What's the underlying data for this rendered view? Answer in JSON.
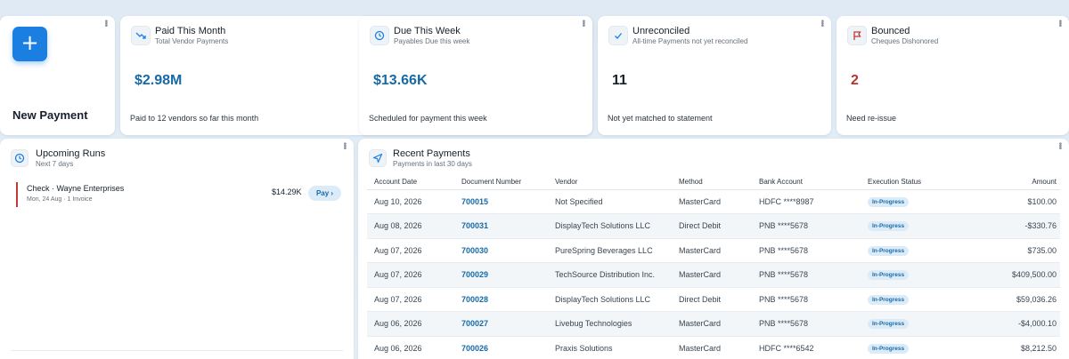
{
  "new_payment": {
    "label": "New Payment",
    "icon": "plus-icon"
  },
  "stats": [
    {
      "title": "Paid This Month",
      "subtitle": "Total Vendor Payments",
      "value": "$2.98M",
      "footer": "Paid to 12 vendors so far this month",
      "icon": "trending-down-icon",
      "color": "#176aa6"
    },
    {
      "title": "Due This Week",
      "subtitle": "Payables Due this week",
      "value": "$13.66K",
      "footer": "Scheduled for payment this week",
      "icon": "clock-icon",
      "color": "#176aa6"
    },
    {
      "title": "Unreconciled",
      "subtitle": "All-time Payments not yet reconciled",
      "value": "11",
      "footer": "Not yet matched to statement",
      "icon": "check-icon",
      "color": "#16202b"
    },
    {
      "title": "Bounced",
      "subtitle": "Cheques Dishonored",
      "value": "2",
      "footer": "Need re-issue",
      "icon": "flag-icon",
      "color": "#b4352f"
    }
  ],
  "runs": {
    "title": "Upcoming Runs",
    "subtitle": "Next 7 days",
    "items": [
      {
        "name": "Check · Wayne Enterprises",
        "meta": "Mon, 24 Aug · 1 Invoice",
        "amount": "$14.29K",
        "action": "Pay ›"
      }
    ]
  },
  "recent": {
    "title": "Recent Payments",
    "subtitle": "Payments in last 30 days",
    "columns": [
      "Account Date",
      "Document Number",
      "Vendor",
      "Method",
      "Bank Account",
      "Execution Status",
      "Amount"
    ],
    "rows": [
      {
        "date": "Aug 10, 2026",
        "doc": "700015",
        "vendor": "Not Specified",
        "method": "MasterCard",
        "bank": "HDFC ****8987",
        "status": "In-Progress",
        "amount": "$100.00"
      },
      {
        "date": "Aug 08, 2026",
        "doc": "700031",
        "vendor": "DisplayTech Solutions LLC",
        "method": "Direct Debit",
        "bank": "PNB ****5678",
        "status": "In-Progress",
        "amount": "-$330.76"
      },
      {
        "date": "Aug 07, 2026",
        "doc": "700030",
        "vendor": "PureSpring Beverages LLC",
        "method": "MasterCard",
        "bank": "PNB ****5678",
        "status": "In-Progress",
        "amount": "$735.00"
      },
      {
        "date": "Aug 07, 2026",
        "doc": "700029",
        "vendor": "TechSource Distribution Inc.",
        "method": "MasterCard",
        "bank": "PNB ****5678",
        "status": "In-Progress",
        "amount": "$409,500.00"
      },
      {
        "date": "Aug 07, 2026",
        "doc": "700028",
        "vendor": "DisplayTech Solutions LLC",
        "method": "Direct Debit",
        "bank": "PNB ****5678",
        "status": "In-Progress",
        "amount": "$59,036.26"
      },
      {
        "date": "Aug 06, 2026",
        "doc": "700027",
        "vendor": "Livebug Technologies",
        "method": "MasterCard",
        "bank": "PNB ****5678",
        "status": "In-Progress",
        "amount": "-$4,000.10"
      },
      {
        "date": "Aug 06, 2026",
        "doc": "700026",
        "vendor": "Praxis Solutions",
        "method": "MasterCard",
        "bank": "HDFC ****6542",
        "status": "In-Progress",
        "amount": "$8,212.50"
      }
    ]
  }
}
